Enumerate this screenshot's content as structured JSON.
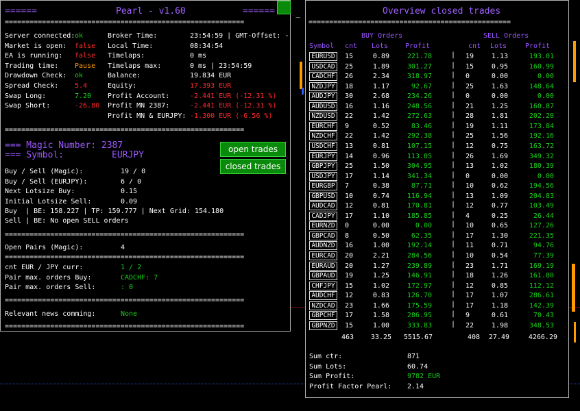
{
  "left": {
    "title": "Pearl - v1.60",
    "title_deco_left": "======",
    "title_deco_right": "======",
    "minimize_glyph": "_",
    "status": [
      {
        "label": "Server connected:",
        "value": "ok",
        "color": "#19d119"
      },
      {
        "label": "Market is open:",
        "value": "false",
        "color": "#ff2a2a"
      },
      {
        "label": "EA is running:",
        "value": "false",
        "color": "#ff2a2a"
      },
      {
        "label": "Trading time:",
        "value": "Pause",
        "color": "#ff9a00"
      },
      {
        "label": "Drawdown Check:",
        "value": "ok",
        "color": "#19d119"
      },
      {
        "label": "Spread Check:",
        "value": "5.4",
        "color": "#ff2a2a"
      },
      {
        "label": "Swap Long:",
        "value": "7.20",
        "color": "#19d119"
      },
      {
        "label": "Swap Short:",
        "value": "-26.80",
        "color": "#ff2a2a"
      }
    ],
    "broker": [
      {
        "label": "Broker Time:",
        "value": "23:54:59 | GMT-Offset: -",
        "color": "#ffffff"
      },
      {
        "label": "Local Time:",
        "value": "08:34:54",
        "color": "#ffffff"
      },
      {
        "label": "Timelaps:",
        "value": "0 ms",
        "color": "#ffffff"
      },
      {
        "label": "Timelaps max:",
        "value": "0 ms | 23:54:59",
        "color": "#ffffff"
      },
      {
        "label": "Balance:",
        "value": "19.834 EUR",
        "color": "#ffffff"
      },
      {
        "label": "Equity:",
        "value": "17.393 EUR",
        "color": "#ff2a2a"
      },
      {
        "label": "Profit Account:",
        "value": "-2.441 EUR (-12.31 %)",
        "color": "#ff2a2a"
      },
      {
        "label": "Profit MN 2387:",
        "value": "-2.441 EUR (-12.31 %)",
        "color": "#ff2a2a"
      },
      {
        "label": "Profit MN & EURJPY:",
        "value": "-1.300 EUR (-6.56 %)",
        "color": "#ff2a2a"
      }
    ],
    "magic_line": "=== Magic Number: 2387",
    "symbol_label": "=== Symbol:",
    "symbol_value": "EURJPY",
    "open_trades_btn": "open trades",
    "closed_trades_btn": "closed trades",
    "info": [
      {
        "label": "Buy / Sell (Magic):",
        "value": "19 / 0"
      },
      {
        "label": "Buy / Sell (EURJPY):",
        "value": "6 / 0"
      },
      {
        "label": "Next Lotsize Buy:",
        "value": "0.15"
      },
      {
        "label": "Initial Lotsize Sell:",
        "value": "0.09"
      }
    ],
    "buy_line": "Buy  | BE: 158.227 | TP: 159.777 | Next Grid: 154.180",
    "sell_line": "Sell | BE: No open SELL orders",
    "open_pairs_label": "Open Pairs (Magic):",
    "open_pairs_value": "4",
    "cnt_label": "cnt EUR / JPY curr:",
    "cnt_value": "1 / 2",
    "pair_max_buy_label": "Pair max. orders Buy:",
    "pair_max_buy_value": "CADCHF: 7",
    "pair_max_sell_label": "Pair max. orders Sell:",
    "pair_max_sell_value": ": 0",
    "news_label": "Relevant news comming:",
    "news_value": "None",
    "separator": "=========================================================="
  },
  "right": {
    "title": "Overview closed trades",
    "separator": "=================================================",
    "buy_header": "BUY Orders",
    "sell_header": "SELL Orders",
    "col_symbol": "Symbol",
    "col_cnt": "cnt",
    "col_lots": "Lots",
    "col_profit": "Profit",
    "rows": [
      [
        "EURUSD",
        "15",
        "0.89",
        "221.78",
        "19",
        "1.13",
        "193.01"
      ],
      [
        "USDCAD",
        "25",
        "1.89",
        "301.27",
        "15",
        "0.95",
        "160.99"
      ],
      [
        "CADCHF",
        "26",
        "2.34",
        "318.97",
        "0",
        "0.00",
        "0.00"
      ],
      [
        "NZDJPY",
        "18",
        "1.17",
        "92.67",
        "25",
        "1.63",
        "148.64"
      ],
      [
        "AUDJPY",
        "30",
        "2.68",
        "234.26",
        "0",
        "0.00",
        "0.00"
      ],
      [
        "AUDUSD",
        "16",
        "1.16",
        "248.56",
        "21",
        "1.25",
        "160.87"
      ],
      [
        "NZDUSD",
        "22",
        "1.42",
        "272.63",
        "28",
        "1.81",
        "202.20"
      ],
      [
        "EURCHF",
        "9",
        "0.52",
        "83.46",
        "19",
        "1.11",
        "173.84"
      ],
      [
        "NZDCHF",
        "22",
        "1.42",
        "292.38",
        "25",
        "1.56",
        "192.16"
      ],
      [
        "USDCHF",
        "13",
        "0.81",
        "107.15",
        "12",
        "0.75",
        "163.72"
      ],
      [
        "EURJPY",
        "14",
        "0.96",
        "113.05",
        "26",
        "1.69",
        "349.32"
      ],
      [
        "GBPJPY",
        "25",
        "1.50",
        "304.95",
        "13",
        "1.02",
        "180.39"
      ],
      [
        "USDJPY",
        "17",
        "1.14",
        "341.34",
        "0",
        "0.00",
        "0.00"
      ],
      [
        "EURGBP",
        "7",
        "0.38",
        "87.71",
        "10",
        "0.62",
        "194.56"
      ],
      [
        "GBPUSD",
        "10",
        "0.74",
        "116.94",
        "13",
        "1.09",
        "204.83"
      ],
      [
        "AUDCAD",
        "12",
        "0.81",
        "170.81",
        "12",
        "0.77",
        "103.49"
      ],
      [
        "CADJPY",
        "17",
        "1.10",
        "185.85",
        "4",
        "0.25",
        "26.44"
      ],
      [
        "EURNZD",
        "0",
        "0.00",
        "0.00",
        "10",
        "0.65",
        "127.26"
      ],
      [
        "GBPCAD",
        "8",
        "0.50",
        "62.35",
        "17",
        "1.30",
        "221.35"
      ],
      [
        "AUDNZD",
        "16",
        "1.00",
        "192.14",
        "11",
        "0.71",
        "94.76"
      ],
      [
        "EURCAD",
        "20",
        "2.21",
        "284.56",
        "10",
        "0.54",
        "77.39"
      ],
      [
        "EURAUD",
        "20",
        "1.27",
        "239.89",
        "23",
        "1.71",
        "169.19"
      ],
      [
        "GBPAUD",
        "19",
        "1.25",
        "146.91",
        "18",
        "1.26",
        "161.80"
      ],
      [
        "CHFJPY",
        "15",
        "1.02",
        "172.97",
        "12",
        "0.85",
        "112.12"
      ],
      [
        "AUDCHF",
        "12",
        "0.83",
        "126.70",
        "17",
        "1.07",
        "286.61"
      ],
      [
        "NZDCAD",
        "23",
        "1.66",
        "175.59",
        "17",
        "1.18",
        "142.39"
      ],
      [
        "GBPCHF",
        "17",
        "1.58",
        "286.95",
        "9",
        "0.61",
        "70.43"
      ],
      [
        "GBPNZD",
        "15",
        "1.00",
        "333.83",
        "22",
        "1.98",
        "348.53"
      ]
    ],
    "totals": [
      "463",
      "33.25",
      "5515.67",
      "408",
      "27.49",
      "4266.29"
    ],
    "summary": [
      {
        "label": "Sum ctr:",
        "value": "871",
        "color": "#ffffff"
      },
      {
        "label": "Sum Lots:",
        "value": "60.74",
        "color": "#ffffff"
      },
      {
        "label": "Sum Profit:",
        "value": "9782 EUR",
        "color": "#19d119"
      },
      {
        "label": "Profit Factor Pearl:",
        "value": "2.14",
        "color": "#ffffff"
      }
    ]
  }
}
